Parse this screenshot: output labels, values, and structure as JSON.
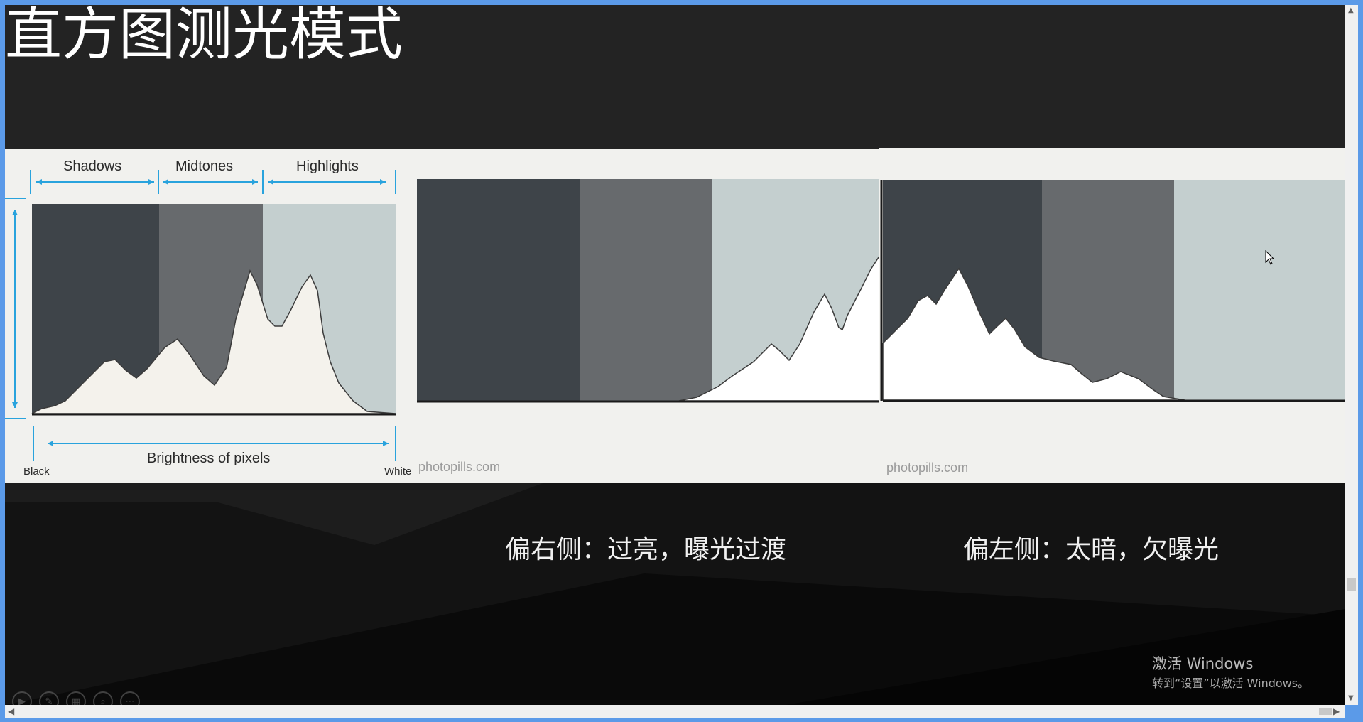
{
  "slide": {
    "title": "直方图测光模式",
    "zones": {
      "shadows": "Shadows",
      "midtones": "Midtones",
      "highlights": "Highlights"
    },
    "axis_label": "Brightness of pixels",
    "axis_left": "Black",
    "axis_right": "White",
    "watermark_mid": "photopills.com",
    "watermark_right": "photopills.com",
    "caption_right_skew": "偏右侧：过亮，曝光过渡",
    "caption_left_skew": "偏左侧：太暗，欠曝光"
  },
  "system": {
    "activate_title": "激活 Windows",
    "activate_sub": "转到“设置”以激活 Windows。"
  },
  "controls": [
    {
      "name": "play-icon",
      "glyph": "▶"
    },
    {
      "name": "pen-icon",
      "glyph": "✎"
    },
    {
      "name": "slides-grid-icon",
      "glyph": "▦"
    },
    {
      "name": "zoom-icon",
      "glyph": "⌕"
    },
    {
      "name": "more-icon",
      "glyph": "⋯"
    }
  ],
  "colors": {
    "slide_bg": "#232323",
    "panel_bg": "#f1f1ee",
    "shadow_zone": "#3e4449",
    "midtone_zone": "#676a6d",
    "highlight_zone": "#c4cfcf",
    "accent_arrow": "#29a3dd"
  }
}
